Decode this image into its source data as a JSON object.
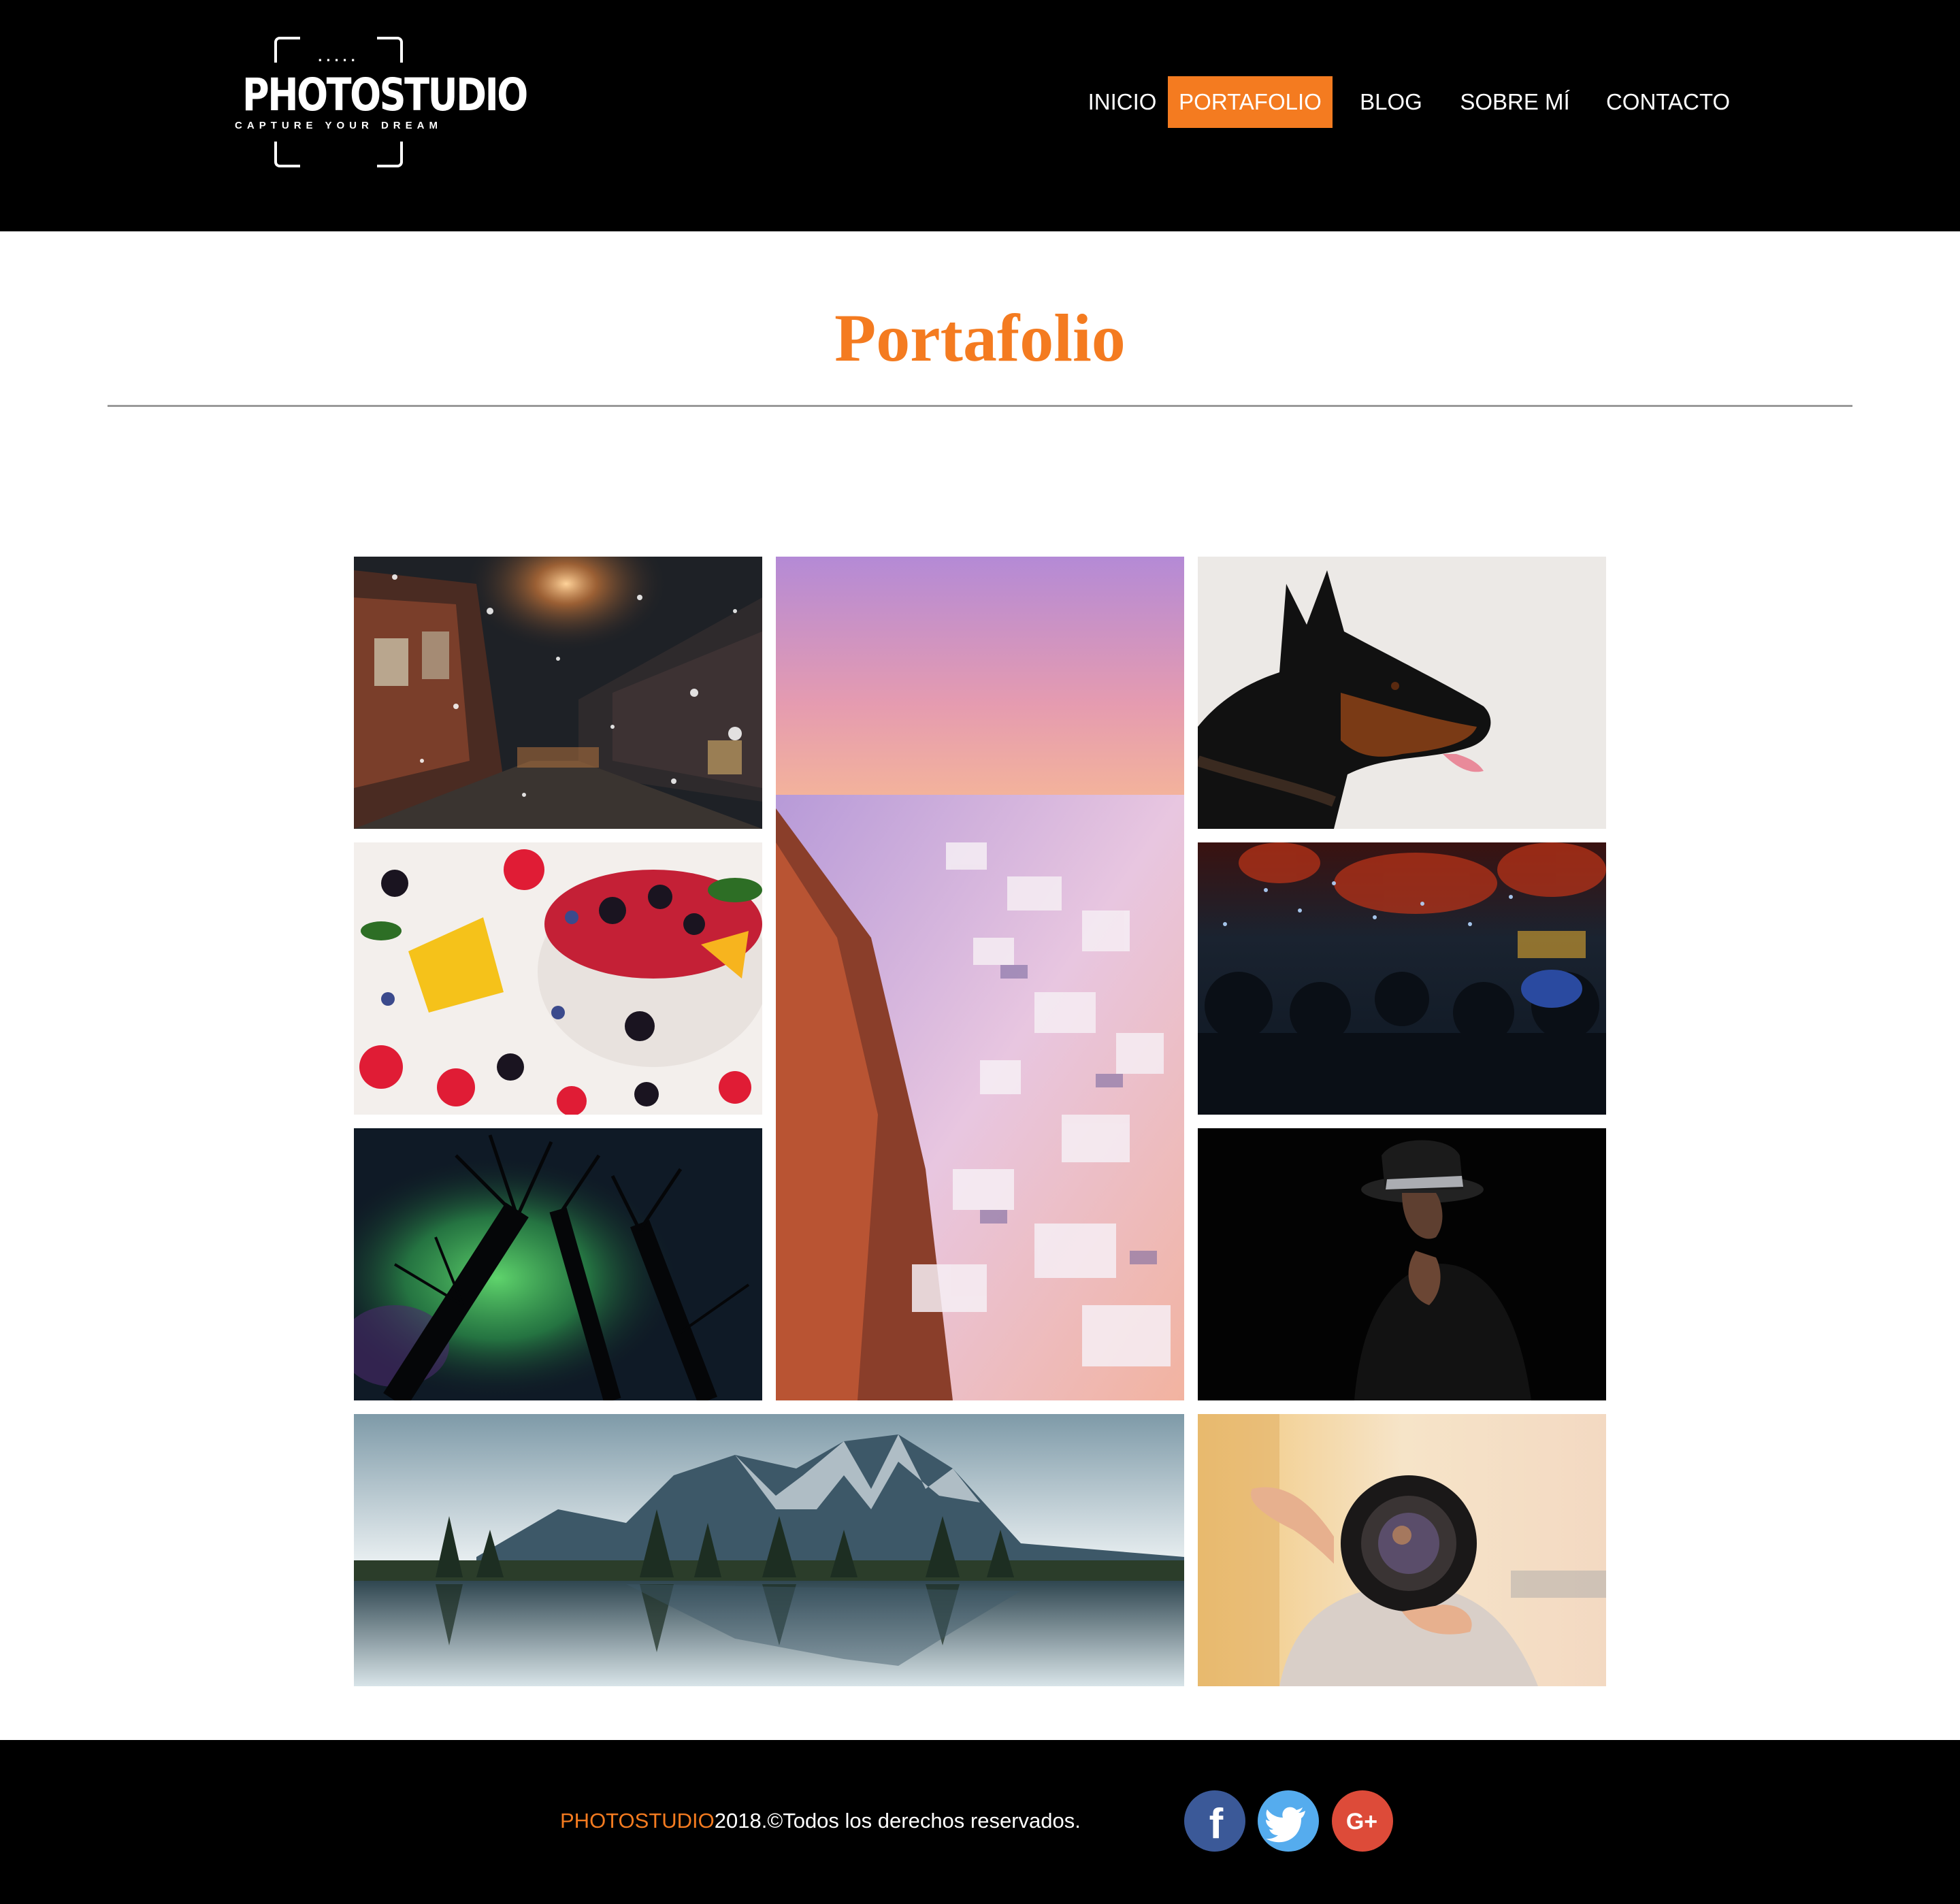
{
  "header": {
    "logo": {
      "dots": ".....",
      "brand": "PHOTOSTUDIO",
      "tagline": "CAPTURE YOUR DREAM"
    },
    "nav": [
      {
        "label": "INICIO",
        "active": false
      },
      {
        "label": "PORTAFOLIO",
        "active": true
      },
      {
        "label": "BLOG",
        "active": false
      },
      {
        "label": "SOBRE MÍ",
        "active": false
      },
      {
        "label": "CONTACTO",
        "active": false
      }
    ]
  },
  "main": {
    "title": "Portafolio",
    "gallery": [
      {
        "subject": "snowy-city-street-night"
      },
      {
        "subject": "santorini-village-sunset"
      },
      {
        "subject": "doberman-dog-profile"
      },
      {
        "subject": "fruit-bowl-berries-mango"
      },
      {
        "subject": "concert-crowd-lights"
      },
      {
        "subject": "northern-lights-trees"
      },
      {
        "subject": "woman-in-hat-dark-portrait"
      },
      {
        "subject": "mountain-lake-reflection"
      },
      {
        "subject": "photographer-with-camera"
      }
    ]
  },
  "footer": {
    "brand": "PHOTOSTUDIO",
    "text": "2018.©Todos los derechos reservados.",
    "social": [
      {
        "icon": "facebook-icon",
        "glyph": "f",
        "color": "#3b5998"
      },
      {
        "icon": "twitter-icon",
        "glyph": "t",
        "color": "#55acee"
      },
      {
        "icon": "google-plus-icon",
        "glyph": "G+",
        "color": "#dd4b39"
      }
    ]
  },
  "colors": {
    "accent": "#f47b20",
    "header_bg": "#000000",
    "footer_bg": "#000000"
  }
}
